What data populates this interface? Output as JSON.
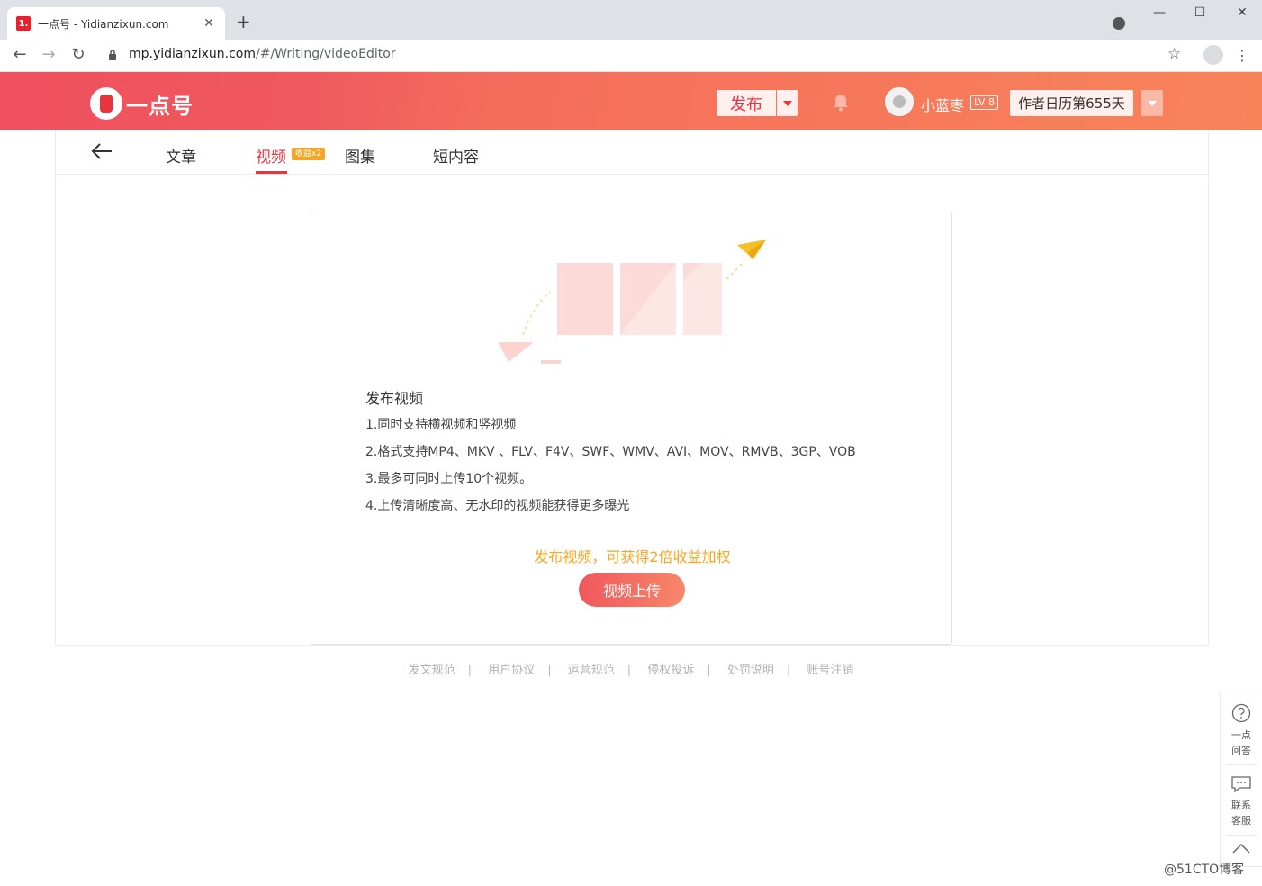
{
  "browser": {
    "tab_favicon": "1.",
    "tab_title": "一点号 - Yidianzixun.com",
    "url_host": "mp.yidianzixun.com",
    "url_path": "/#/Writing/videoEditor"
  },
  "header": {
    "logo_text": "一点号",
    "publish_label": "发布",
    "username": "小蓝枣",
    "level": "LV 8",
    "calendar_label": "作者日历第655天"
  },
  "content_tabs": [
    {
      "label": "文章"
    },
    {
      "label": "视频",
      "badge": "收益x2"
    },
    {
      "label": "图集"
    },
    {
      "label": "短内容"
    }
  ],
  "upload": {
    "title": "发布视频",
    "lines": [
      "1.同时支持横视频和竖视频",
      "2.格式支持MP4、MKV 、FLV、F4V、SWF、WMV、AVI、MOV、RMVB、3GP、VOB",
      "3.最多可同时上传10个视频。",
      "4.上传清晰度高、无水印的视频能获得更多曝光"
    ],
    "promo": "发布视频，可获得2倍收益加权",
    "button_label": "视频上传"
  },
  "footer_links": [
    "发文规范",
    "用户协议",
    "运营规范",
    "侵权投诉",
    "处罚说明",
    "账号注销"
  ],
  "float_bar": {
    "qa_label_1": "一点",
    "qa_label_2": "问答",
    "service_label_1": "联系",
    "service_label_2": "客服"
  },
  "watermark": "@51CTO博客",
  "colors": {
    "brand_red": "#e8343f",
    "promo_orange": "#f5a623",
    "header_gradient_start": "#ef4f5f",
    "header_gradient_end": "#f8845a"
  }
}
